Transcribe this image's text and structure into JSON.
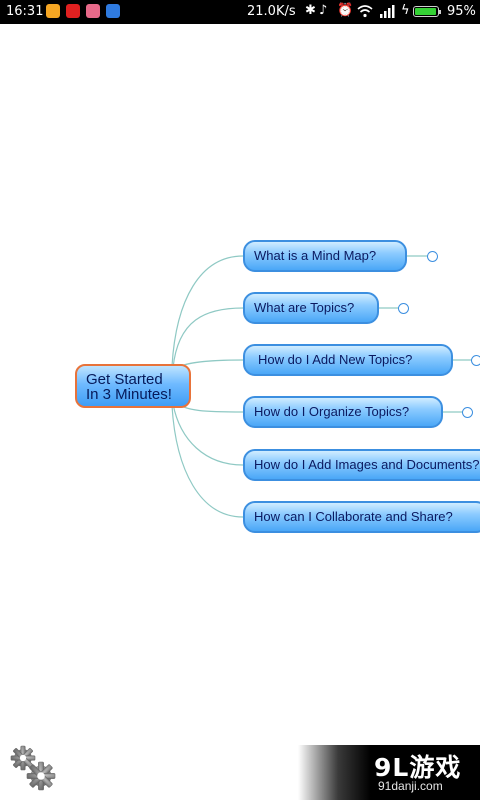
{
  "status_bar": {
    "time": "16:31",
    "network_speed": "21.0K/s",
    "battery_percent_text": "95%",
    "battery_level": 0.95,
    "icons": [
      "weibo-icon",
      "sohu-icon",
      "app-icon",
      "tieba-icon",
      "bluetooth-icon",
      "mute-icon",
      "alarm-icon",
      "wifi-icon",
      "signal-icon",
      "charging-icon",
      "battery-icon"
    ]
  },
  "mind_map": {
    "central_topic": {
      "line1": "Get Started",
      "line2": "In 3 Minutes!"
    },
    "topics": [
      {
        "label": "What is a Mind Map?"
      },
      {
        "label": "What are Topics?"
      },
      {
        "label": "How do I Add New Topics?"
      },
      {
        "label": "How do I Organize Topics?"
      },
      {
        "label": "How do I Add Images and Documents?"
      },
      {
        "label": "How can I Collaborate and Share?"
      }
    ],
    "colors": {
      "topic_fill": "#6fbaff",
      "topic_border": "#3c8fe0",
      "central_border": "#e8733a",
      "connector": "#8fc9c4"
    }
  },
  "toolbar": {
    "settings_icon": "gears-icon"
  },
  "watermark": {
    "logo": "9L游戏",
    "url": "91danji.com"
  }
}
